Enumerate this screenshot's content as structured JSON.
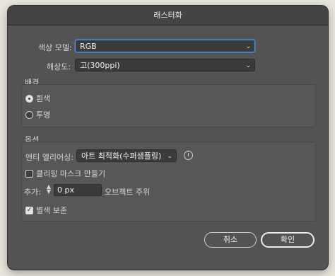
{
  "window": {
    "title": "래스터화"
  },
  "color_model": {
    "label": "색상 모델:",
    "value": "RGB"
  },
  "resolution": {
    "label": "해상도:",
    "value": "고(300ppi)"
  },
  "background": {
    "heading": "배경",
    "options": [
      {
        "label": "흰색",
        "selected": true
      },
      {
        "label": "투명",
        "selected": false
      }
    ]
  },
  "options": {
    "heading": "옵션",
    "antialiasing": {
      "label": "앤티 앨리어싱:",
      "value": "아트 최적화(수퍼샘플링)"
    },
    "clipping_mask": {
      "label": "클리핑 마스크 만들기",
      "checked": false
    },
    "add": {
      "label": "추가:",
      "value": "0 px",
      "suffix": "오브젝트 주위"
    },
    "preserve_spot": {
      "label": "별색 보존",
      "checked": true
    }
  },
  "buttons": {
    "cancel": "취소",
    "ok": "확인"
  }
}
